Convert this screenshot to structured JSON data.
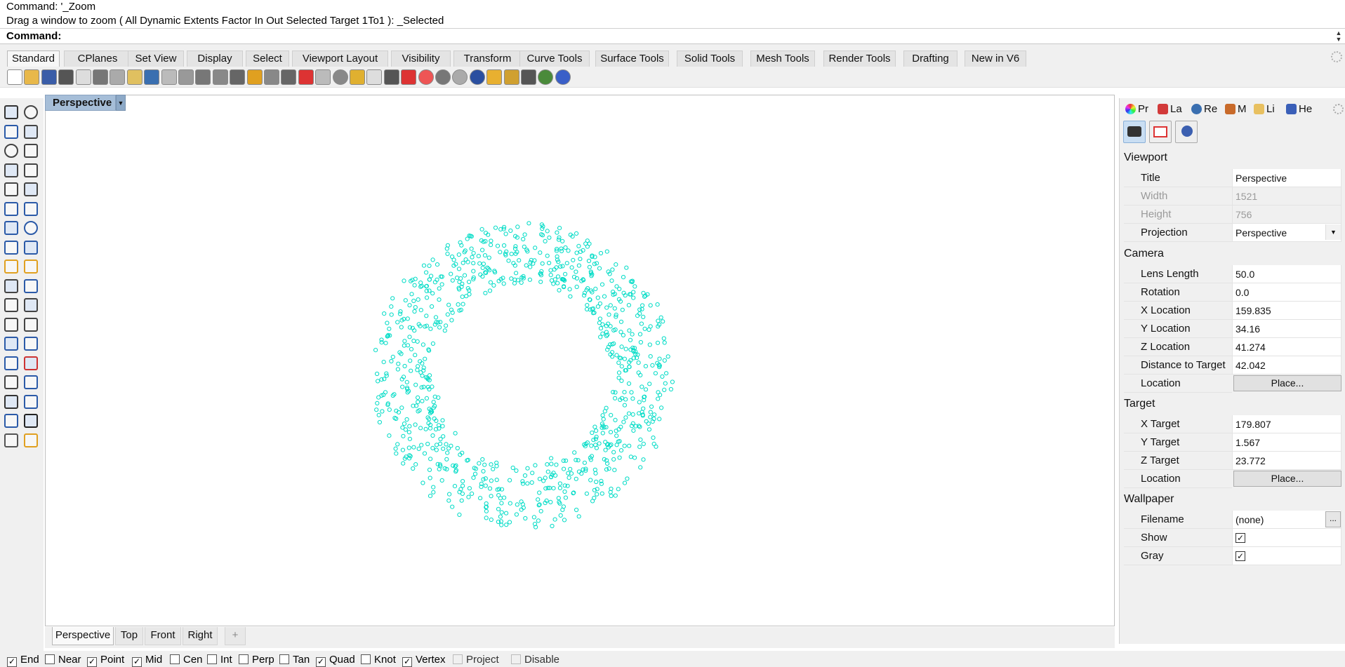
{
  "command": {
    "history": [
      "Command: '_Zoom",
      "Drag a window to zoom ( All  Dynamic  Extents  Factor  In  Out  Selected  Target  1To1 ): _Selected"
    ],
    "prompt": "Command:"
  },
  "tabs": [
    "Standard",
    "CPlanes",
    "Set View",
    "Display",
    "Select",
    "Viewport Layout",
    "Visibility",
    "Transform",
    "Curve Tools",
    "Surface Tools",
    "Solid Tools",
    "Mesh Tools",
    "Render Tools",
    "Drafting",
    "New in V6"
  ],
  "active_tab": "Standard",
  "toolbar_icons": [
    "new-file-icon",
    "open-file-icon",
    "save-icon",
    "print-icon",
    "import-icon",
    "cut-icon",
    "copy-icon",
    "paste-icon",
    "undo-icon",
    "pan-icon",
    "rotate-view-icon",
    "zoom-icon",
    "zoom-window-icon",
    "zoom-extents-icon",
    "zoom-selected-icon",
    "rotate-icon",
    "four-viewports-icon",
    "car-icon",
    "shaded-icon",
    "circle-icon",
    "points-icon",
    "light-icon",
    "lock-icon",
    "materials-icon",
    "color-wheel-icon",
    "render-sphere-icon",
    "rendered-sphere-icon",
    "sphere-icon",
    "select-filter-icon",
    "settings-gear-icon",
    "dimension-icon",
    "sphere-green-icon",
    "help-icon"
  ],
  "viewport": {
    "title": "Perspective",
    "point_color": "#00dcc6"
  },
  "viewport_tabs": [
    "Perspective",
    "Top",
    "Front",
    "Right"
  ],
  "add_tab": "+",
  "osnap": [
    {
      "label": "End",
      "checked": true
    },
    {
      "label": "Near",
      "checked": false
    },
    {
      "label": "Point",
      "checked": true
    },
    {
      "label": "Mid",
      "checked": true
    },
    {
      "label": "Cen",
      "checked": false
    },
    {
      "label": "Int",
      "checked": false
    },
    {
      "label": "Perp",
      "checked": false
    },
    {
      "label": "Tan",
      "checked": false
    },
    {
      "label": "Quad",
      "checked": true
    },
    {
      "label": "Knot",
      "checked": false
    },
    {
      "label": "Vertex",
      "checked": true
    },
    {
      "label": "Project",
      "checked": false
    },
    {
      "label": "Disable",
      "checked": false
    }
  ],
  "panel_tabs": [
    "Pr",
    "La",
    "Re",
    "M",
    "Li",
    "He"
  ],
  "properties": {
    "viewport_header": "Viewport",
    "title_label": "Title",
    "title_value": "Perspective",
    "width_label": "Width",
    "width_value": "1521",
    "height_label": "Height",
    "height_value": "756",
    "projection_label": "Projection",
    "projection_value": "Perspective",
    "camera_header": "Camera",
    "lens_label": "Lens Length",
    "lens_value": "50.0",
    "rotation_label": "Rotation",
    "rotation_value": "0.0",
    "xloc_label": "X Location",
    "xloc_value": "159.835",
    "yloc_label": "Y Location",
    "yloc_value": "34.16",
    "zloc_label": "Z Location",
    "zloc_value": "41.274",
    "dist_label": "Distance to Target",
    "dist_value": "42.042",
    "cam_location_label": "Location",
    "place_label": "Place...",
    "target_header": "Target",
    "xt_label": "X Target",
    "xt_value": "179.807",
    "yt_label": "Y Target",
    "yt_value": "1.567",
    "zt_label": "Z Target",
    "zt_value": "23.772",
    "target_location_label": "Location",
    "wallpaper_header": "Wallpaper",
    "filename_label": "Filename",
    "filename_value": "(none)",
    "browse_label": "...",
    "show_label": "Show",
    "show_checked": true,
    "gray_label": "Gray",
    "gray_checked": true
  }
}
